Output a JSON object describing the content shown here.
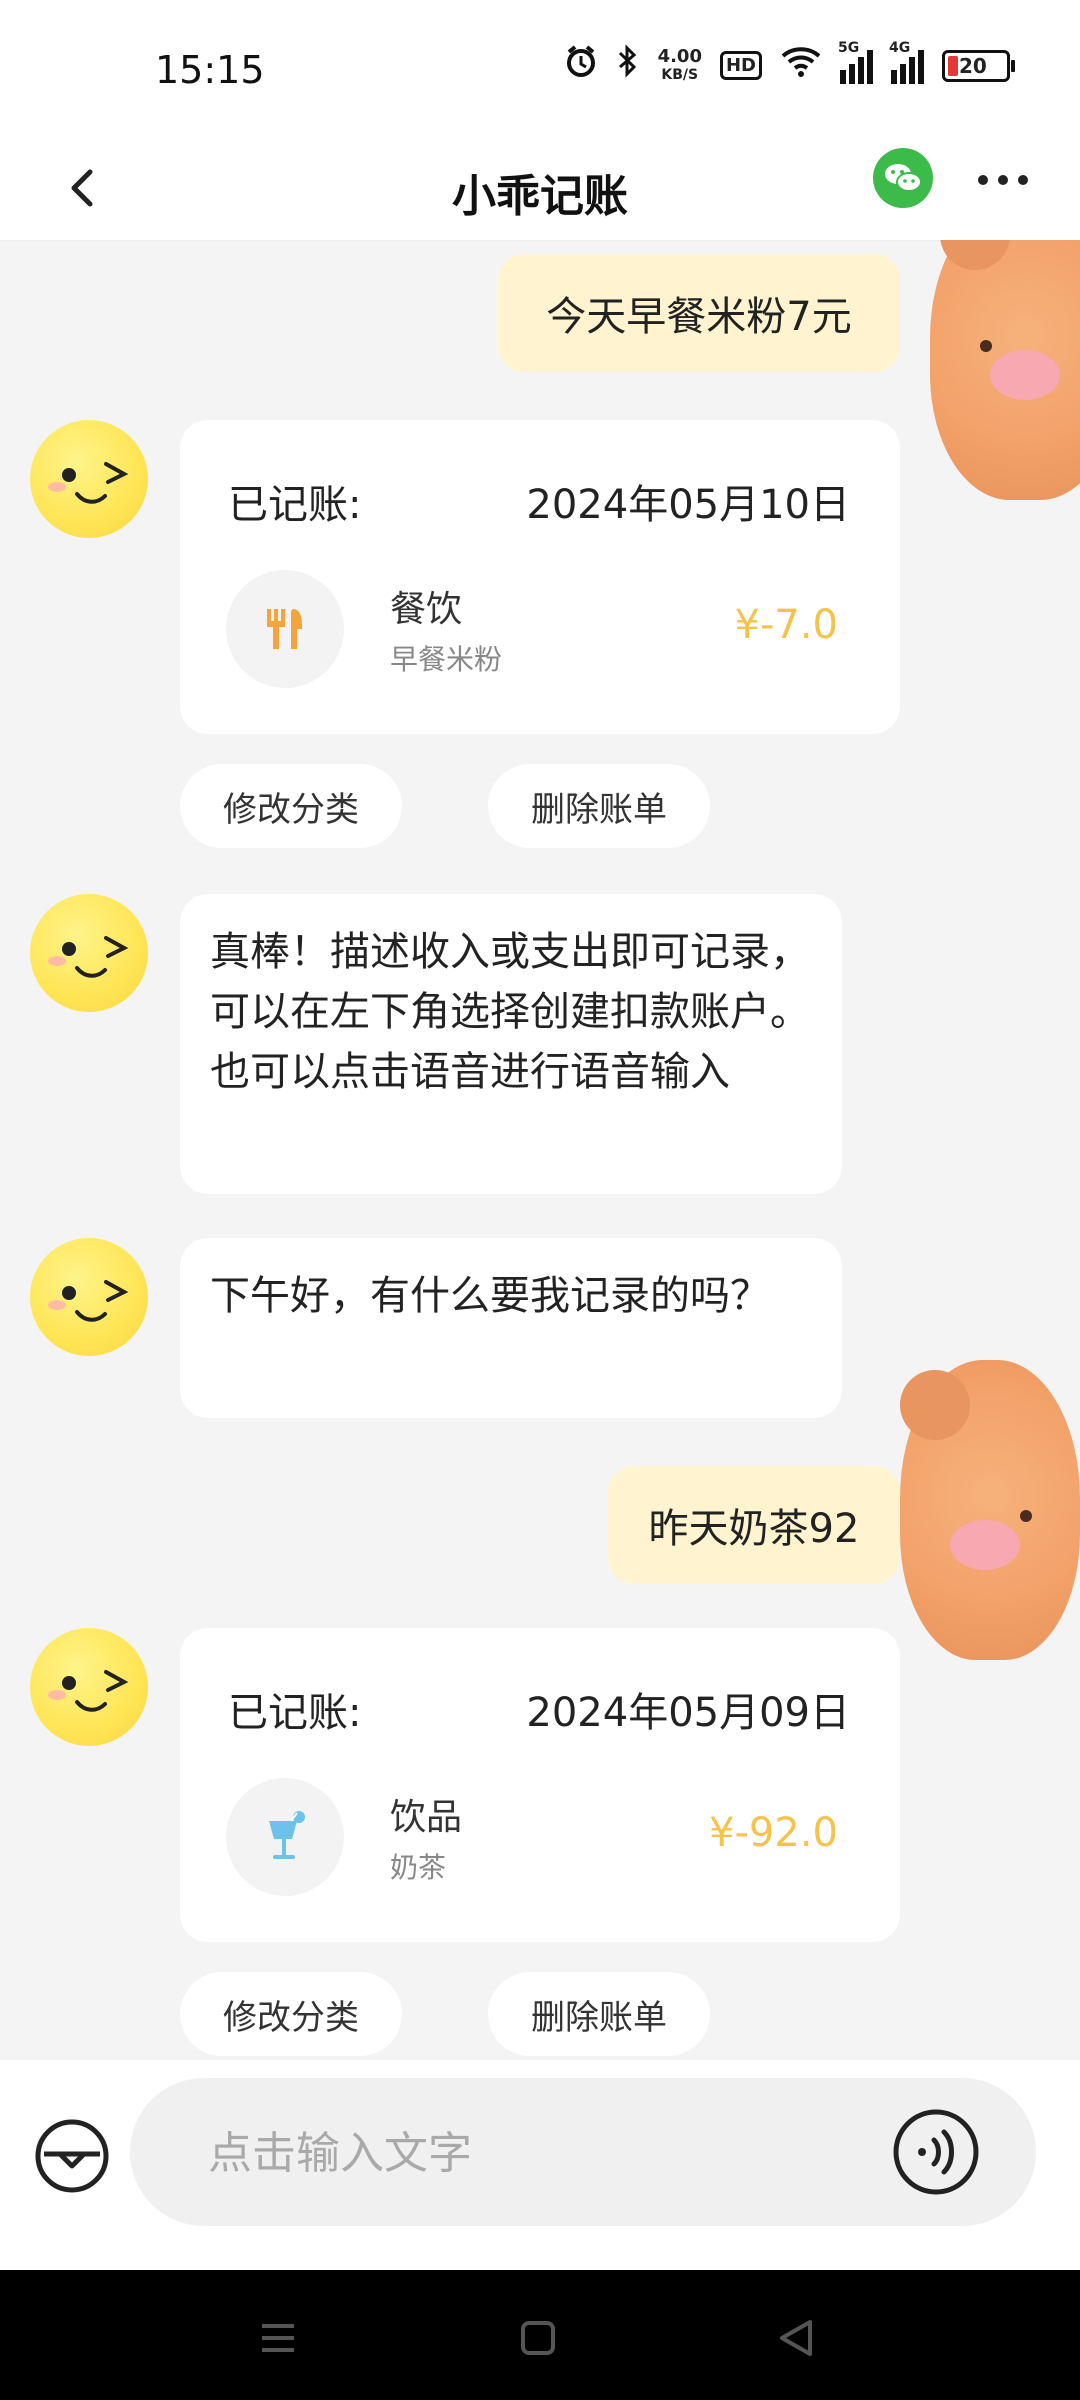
{
  "status_bar": {
    "time": "15:15",
    "net_speed_value": "4.00",
    "net_speed_unit": "KB/S",
    "hd_label": "HD",
    "sig1_label": "5G",
    "sig2_label": "4G",
    "battery_level": "20"
  },
  "header": {
    "title": "小乖记账"
  },
  "chat": {
    "user_msg_1": "今天早餐米粉7元",
    "record_1": {
      "title": "已记账:",
      "date": "2024年05月10日",
      "category": "餐饮",
      "note": "早餐米粉",
      "amount": "¥-7.0"
    },
    "edit_label": "修改分类",
    "delete_label": "删除账单",
    "bot_msg_1": "真棒！描述收入或支出即可记录，可以在左下角选择创建扣款账户。也可以点击语音进行语音输入",
    "bot_msg_2": "下午好，有什么要我记录的吗？",
    "user_msg_2": "昨天奶茶92",
    "record_2": {
      "title": "已记账:",
      "date": "2024年05月09日",
      "category": "饮品",
      "note": "奶茶",
      "amount": "¥-92.0"
    }
  },
  "composer": {
    "placeholder": "点击输入文字"
  },
  "colors": {
    "accent_yellow": "#f5c34a",
    "user_bubble": "#fff4cf",
    "wechat_green": "#3dbb4a"
  }
}
